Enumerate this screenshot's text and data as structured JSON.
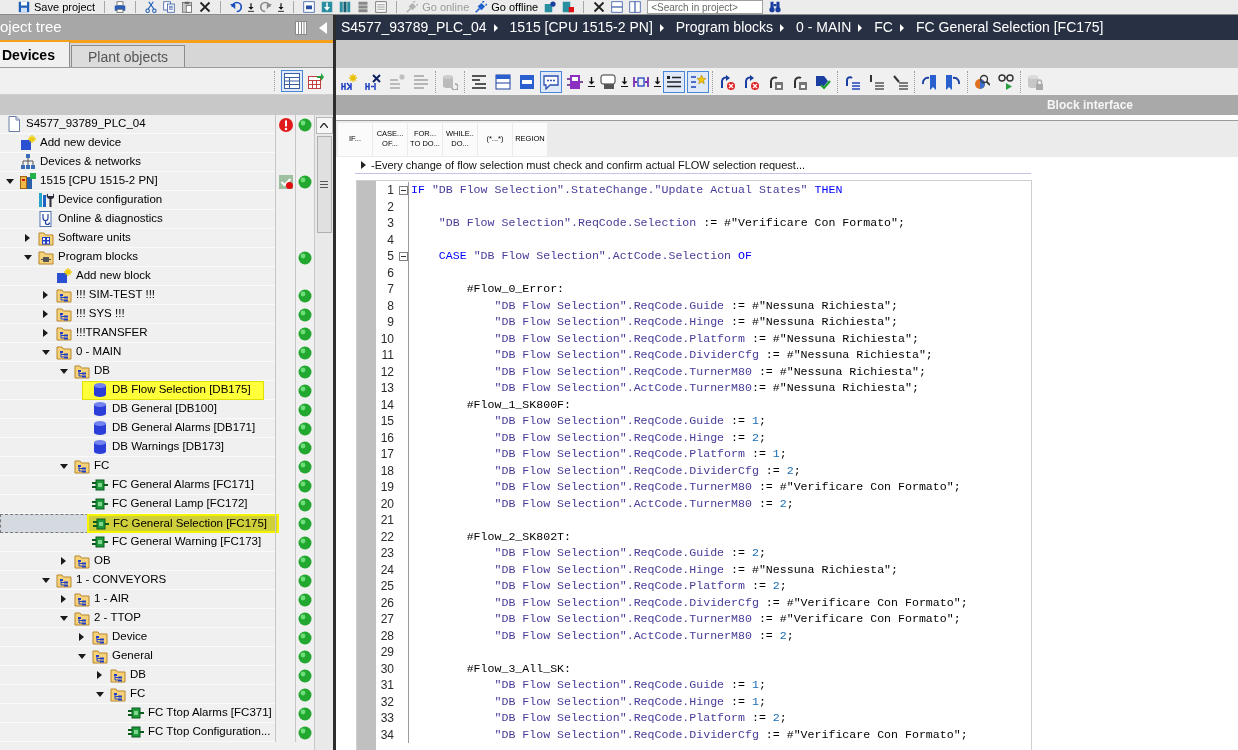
{
  "main_toolbar": {
    "save": {
      "label": "Save project",
      "disabled": false
    },
    "go_online": {
      "label": "Go online",
      "disabled": true
    },
    "go_offline": {
      "label": "Go offline",
      "disabled": false
    },
    "search": {
      "placeholder": "<Search in project>"
    }
  },
  "project_tree": {
    "title": "oject tree",
    "tabs": [
      {
        "label": "Devices",
        "selected": true
      },
      {
        "label": "Plant objects",
        "selected": false
      }
    ],
    "toolbar": [
      {
        "on": true
      },
      {
        "on": false
      }
    ],
    "items": [
      {
        "label": "S4577_93789_PLC_04",
        "kind": "project",
        "selected": false,
        "highlighted": false,
        "error_mark": true,
        "status_dot": true,
        "children": [
          {
            "label": "Add new device",
            "kind": "add-device",
            "selected": false,
            "highlighted": false
          },
          {
            "label": "Devices & networks",
            "kind": "network",
            "selected": false,
            "highlighted": false
          },
          {
            "label": "1515 [CPU 1515-2 PN]",
            "kind": "cpu",
            "selected": false,
            "highlighted": false,
            "expanded": true,
            "check_mark": true,
            "status_dot": true,
            "children": [
              {
                "label": "Device configuration",
                "kind": "device-config",
                "selected": false,
                "highlighted": false
              },
              {
                "label": "Online & diagnostics",
                "kind": "diagnostics",
                "selected": false,
                "highlighted": false
              },
              {
                "label": "Software units",
                "kind": "software-units",
                "selected": false,
                "highlighted": false,
                "expanded": false
              },
              {
                "label": "Program blocks",
                "kind": "program-blocks",
                "selected": false,
                "highlighted": false,
                "expanded": true,
                "status_dot": true,
                "children": [
                  {
                    "label": "Add new block",
                    "kind": "add-block",
                    "selected": false,
                    "highlighted": false
                  },
                  {
                    "label": "!!! SIM-TEST !!!",
                    "kind": "group",
                    "selected": false,
                    "highlighted": false,
                    "expanded": false,
                    "status_dot": true
                  },
                  {
                    "label": "!!! SYS !!!",
                    "kind": "group",
                    "selected": false,
                    "highlighted": false,
                    "expanded": false,
                    "status_dot": true
                  },
                  {
                    "label": "!!!TRANSFER",
                    "kind": "group",
                    "selected": false,
                    "highlighted": false,
                    "expanded": false,
                    "status_dot": true
                  },
                  {
                    "label": "0 - MAIN",
                    "kind": "group",
                    "selected": false,
                    "highlighted": false,
                    "expanded": true,
                    "status_dot": true,
                    "children": [
                      {
                        "label": "DB",
                        "kind": "group",
                        "selected": false,
                        "highlighted": false,
                        "expanded": true,
                        "status_dot": true,
                        "children": [
                          {
                            "label": "DB Flow Selection [DB175]",
                            "kind": "db",
                            "selected": false,
                            "highlighted": true,
                            "status_dot": true
                          },
                          {
                            "label": "DB General [DB100]",
                            "kind": "db",
                            "selected": false,
                            "highlighted": false,
                            "status_dot": true
                          },
                          {
                            "label": "DB General Alarms [DB171]",
                            "kind": "db",
                            "selected": false,
                            "highlighted": false,
                            "status_dot": true
                          },
                          {
                            "label": "DB Warnings [DB173]",
                            "kind": "db",
                            "selected": false,
                            "highlighted": false,
                            "status_dot": true
                          }
                        ]
                      },
                      {
                        "label": "FC",
                        "kind": "group",
                        "selected": false,
                        "highlighted": false,
                        "expanded": true,
                        "status_dot": true,
                        "children": [
                          {
                            "label": "FC General Alarms [FC171]",
                            "kind": "fc",
                            "selected": false,
                            "highlighted": false,
                            "status_dot": true
                          },
                          {
                            "label": "FC General Lamp [FC172]",
                            "kind": "fc",
                            "selected": false,
                            "highlighted": false,
                            "status_dot": true
                          },
                          {
                            "label": "FC General Selection [FC175]",
                            "kind": "fc",
                            "selected": true,
                            "highlighted": true,
                            "status_dot": true
                          },
                          {
                            "label": "FC General Warning [FC173]",
                            "kind": "fc",
                            "selected": false,
                            "highlighted": false,
                            "status_dot": true
                          }
                        ]
                      },
                      {
                        "label": "OB",
                        "kind": "group",
                        "selected": false,
                        "highlighted": false,
                        "expanded": false,
                        "status_dot": true
                      }
                    ]
                  },
                  {
                    "label": "1 - CONVEYORS",
                    "kind": "group",
                    "selected": false,
                    "highlighted": false,
                    "expanded": true,
                    "status_dot": true,
                    "children": [
                      {
                        "label": "1 - AIR",
                        "kind": "group",
                        "selected": false,
                        "highlighted": false,
                        "expanded": false,
                        "status_dot": true
                      },
                      {
                        "label": "2 - TTOP",
                        "kind": "group",
                        "selected": false,
                        "highlighted": false,
                        "expanded": true,
                        "status_dot": true,
                        "children": [
                          {
                            "label": "Device",
                            "kind": "group",
                            "selected": false,
                            "highlighted": false,
                            "expanded": false,
                            "status_dot": true
                          },
                          {
                            "label": "General",
                            "kind": "group",
                            "selected": false,
                            "highlighted": false,
                            "expanded": true,
                            "status_dot": true,
                            "children": [
                              {
                                "label": "DB",
                                "kind": "group",
                                "selected": false,
                                "highlighted": false,
                                "expanded": false,
                                "status_dot": true
                              },
                              {
                                "label": "FC",
                                "kind": "group",
                                "selected": false,
                                "highlighted": false,
                                "expanded": true,
                                "status_dot": true,
                                "children": [
                                  {
                                    "label": "FC Ttop Alarms [FC371]",
                                    "kind": "fc",
                                    "selected": false,
                                    "highlighted": false,
                                    "status_dot": true
                                  },
                                  {
                                    "label": "FC Ttop Configuration...",
                                    "kind": "fc",
                                    "selected": false,
                                    "highlighted": false,
                                    "status_dot": true
                                  }
                                ]
                              }
                            ]
                          }
                        ]
                      }
                    ]
                  }
                ]
              }
            ]
          }
        ]
      }
    ]
  },
  "editor": {
    "breadcrumb": [
      "S4577_93789_PLC_04",
      "1515 [CPU 1515-2 PN]",
      "Program blocks",
      "0 - MAIN",
      "FC",
      "FC General Selection [FC175]"
    ],
    "toolbar": {
      "groups": [
        [
          {
            "on": false,
            "disabled": false
          },
          {
            "on": false,
            "disabled": false
          },
          {
            "on": false,
            "disabled": true
          },
          {
            "on": false,
            "disabled": true
          }
        ],
        [
          {
            "on": false,
            "disabled": true
          }
        ],
        [
          {
            "on": false,
            "disabled": false
          },
          {
            "on": false,
            "disabled": false
          },
          {
            "on": false,
            "disabled": false
          },
          {
            "on": true,
            "disabled": false
          },
          {
            "on": false,
            "disabled": false
          },
          {
            "on": false,
            "disabled": false
          },
          {
            "on": false,
            "disabled": false
          },
          {
            "on": true,
            "disabled": false
          },
          {
            "on": true,
            "disabled": false
          }
        ],
        [
          {
            "on": false,
            "disabled": false
          },
          {
            "on": false,
            "disabled": false
          },
          {
            "on": false,
            "disabled": false
          },
          {
            "on": false,
            "disabled": false
          },
          {
            "on": false,
            "disabled": false
          }
        ],
        [
          {
            "on": false,
            "disabled": false
          },
          {
            "on": false,
            "disabled": false
          },
          {
            "on": false,
            "disabled": false
          }
        ],
        [
          {
            "on": false,
            "disabled": false
          },
          {
            "on": false,
            "disabled": false
          }
        ],
        [
          {
            "on": false,
            "disabled": false
          },
          {
            "on": false,
            "disabled": false
          }
        ],
        [
          {
            "on": false,
            "disabled": true
          }
        ]
      ]
    },
    "block_interface": {
      "label": "Block interface"
    },
    "instructions": [
      {
        "lines": [
          "IF..."
        ]
      },
      {
        "lines": [
          "CASE...",
          "OF..."
        ]
      },
      {
        "lines": [
          "FOR...",
          "TO DO..."
        ]
      },
      {
        "lines": [
          "WHILE..",
          "DO..."
        ]
      },
      {
        "lines": [
          "(*...*)"
        ]
      },
      {
        "lines": [
          "REGION"
        ]
      }
    ],
    "comment": {
      "text": "-Every change of flow selection must check and confirm actual FLOW selection request...",
      "expanded": false
    },
    "code": {
      "lines": [
        {
          "number": "1",
          "expanded": true,
          "tokens": [
            {
              "kind": "keyword",
              "text": "IF"
            },
            {
              "kind": "tag",
              "text": " \"DB Flow Selection\".StateChange.\"Update Actual States\" "
            },
            {
              "kind": "keyword",
              "text": "THEN"
            }
          ]
        },
        {
          "number": "2"
        },
        {
          "number": "3",
          "tokens": [
            {
              "kind": "tag",
              "text": "    \"DB Flow Selection\".ReqCode.Selection"
            },
            {
              "kind": "plain",
              "text": " := #\"Verificare Con Formato\";"
            }
          ]
        },
        {
          "number": "4"
        },
        {
          "number": "5",
          "expanded": true,
          "tokens": [
            {
              "kind": "keyword",
              "text": "    CASE"
            },
            {
              "kind": "tag",
              "text": " \"DB Flow Selection\".ActCode.Selection "
            },
            {
              "kind": "keyword",
              "text": "OF"
            }
          ]
        },
        {
          "number": "6"
        },
        {
          "number": "7",
          "tokens": [
            {
              "kind": "plain",
              "text": "        #Flow_0_Error:"
            }
          ]
        },
        {
          "number": "8",
          "tokens": [
            {
              "kind": "tag",
              "text": "            \"DB Flow Selection\".ReqCode.Guide"
            },
            {
              "kind": "plain",
              "text": " := #\"Nessuna Richiesta\";"
            }
          ]
        },
        {
          "number": "9",
          "tokens": [
            {
              "kind": "tag",
              "text": "            \"DB Flow Selection\".ReqCode.Hinge"
            },
            {
              "kind": "plain",
              "text": " := #\"Nessuna Richiesta\";"
            }
          ]
        },
        {
          "number": "10",
          "tokens": [
            {
              "kind": "tag",
              "text": "            \"DB Flow Selection\".ReqCode.Platform"
            },
            {
              "kind": "plain",
              "text": " := #\"Nessuna Richiesta\";"
            }
          ]
        },
        {
          "number": "11",
          "tokens": [
            {
              "kind": "tag",
              "text": "            \"DB Flow Selection\".ReqCode.DividerCfg"
            },
            {
              "kind": "plain",
              "text": " := #\"Nessuna Richiesta\";"
            }
          ]
        },
        {
          "number": "12",
          "tokens": [
            {
              "kind": "tag",
              "text": "            \"DB Flow Selection\".ReqCode.TurnerM80"
            },
            {
              "kind": "plain",
              "text": " := #\"Nessuna Richiesta\";"
            }
          ]
        },
        {
          "number": "13",
          "tokens": [
            {
              "kind": "tag",
              "text": "            \"DB Flow Selection\".ActCode.TurnerM80"
            },
            {
              "kind": "plain",
              "text": ":= #\"Nessuna Richiesta\";"
            }
          ]
        },
        {
          "number": "14",
          "tokens": [
            {
              "kind": "plain",
              "text": "        #Flow_1_SK800F:"
            }
          ]
        },
        {
          "number": "15",
          "tokens": [
            {
              "kind": "tag",
              "text": "            \"DB Flow Selection\".ReqCode.Guide"
            },
            {
              "kind": "plain",
              "text": " := "
            },
            {
              "kind": "number",
              "text": "1"
            },
            {
              "kind": "plain",
              "text": ";"
            }
          ]
        },
        {
          "number": "16",
          "tokens": [
            {
              "kind": "tag",
              "text": "            \"DB Flow Selection\".ReqCode.Hinge"
            },
            {
              "kind": "plain",
              "text": " := "
            },
            {
              "kind": "number",
              "text": "2"
            },
            {
              "kind": "plain",
              "text": ";"
            }
          ]
        },
        {
          "number": "17",
          "tokens": [
            {
              "kind": "tag",
              "text": "            \"DB Flow Selection\".ReqCode.Platform"
            },
            {
              "kind": "plain",
              "text": " := "
            },
            {
              "kind": "number",
              "text": "1"
            },
            {
              "kind": "plain",
              "text": ";"
            }
          ]
        },
        {
          "number": "18",
          "tokens": [
            {
              "kind": "tag",
              "text": "            \"DB Flow Selection\".ReqCode.DividerCfg"
            },
            {
              "kind": "plain",
              "text": " := "
            },
            {
              "kind": "number",
              "text": "2"
            },
            {
              "kind": "plain",
              "text": ";"
            }
          ]
        },
        {
          "number": "19",
          "tokens": [
            {
              "kind": "tag",
              "text": "            \"DB Flow Selection\".ReqCode.TurnerM80"
            },
            {
              "kind": "plain",
              "text": " := #\"Verificare Con Formato\";"
            }
          ]
        },
        {
          "number": "20",
          "tokens": [
            {
              "kind": "tag",
              "text": "            \"DB Flow Selection\".ActCode.TurnerM80"
            },
            {
              "kind": "plain",
              "text": " := "
            },
            {
              "kind": "number",
              "text": "2"
            },
            {
              "kind": "plain",
              "text": ";"
            }
          ]
        },
        {
          "number": "21"
        },
        {
          "number": "22",
          "tokens": [
            {
              "kind": "plain",
              "text": "        #Flow_2_SK802T:"
            }
          ]
        },
        {
          "number": "23",
          "tokens": [
            {
              "kind": "tag",
              "text": "            \"DB Flow Selection\".ReqCode.Guide"
            },
            {
              "kind": "plain",
              "text": " := "
            },
            {
              "kind": "number",
              "text": "2"
            },
            {
              "kind": "plain",
              "text": ";"
            }
          ]
        },
        {
          "number": "24",
          "tokens": [
            {
              "kind": "tag",
              "text": "            \"DB Flow Selection\".ReqCode.Hinge"
            },
            {
              "kind": "plain",
              "text": " := #\"Nessuna Richiesta\";"
            }
          ]
        },
        {
          "number": "25",
          "tokens": [
            {
              "kind": "tag",
              "text": "            \"DB Flow Selection\".ReqCode.Platform"
            },
            {
              "kind": "plain",
              "text": " := "
            },
            {
              "kind": "number",
              "text": "2"
            },
            {
              "kind": "plain",
              "text": ";"
            }
          ]
        },
        {
          "number": "26",
          "tokens": [
            {
              "kind": "tag",
              "text": "            \"DB Flow Selection\".ReqCode.DividerCfg"
            },
            {
              "kind": "plain",
              "text": " := #\"Verificare Con Formato\";"
            }
          ]
        },
        {
          "number": "27",
          "tokens": [
            {
              "kind": "tag",
              "text": "            \"DB Flow Selection\".ReqCode.TurnerM80"
            },
            {
              "kind": "plain",
              "text": " := #\"Verificare Con Formato\";"
            }
          ]
        },
        {
          "number": "28",
          "tokens": [
            {
              "kind": "tag",
              "text": "            \"DB Flow Selection\".ActCode.TurnerM80"
            },
            {
              "kind": "plain",
              "text": " := "
            },
            {
              "kind": "number",
              "text": "2"
            },
            {
              "kind": "plain",
              "text": ";"
            }
          ]
        },
        {
          "number": "29"
        },
        {
          "number": "30",
          "tokens": [
            {
              "kind": "plain",
              "text": "        #Flow_3_All_SK:"
            }
          ]
        },
        {
          "number": "31",
          "tokens": [
            {
              "kind": "tag",
              "text": "            \"DB Flow Selection\".ReqCode.Guide"
            },
            {
              "kind": "plain",
              "text": " := "
            },
            {
              "kind": "number",
              "text": "1"
            },
            {
              "kind": "plain",
              "text": ";"
            }
          ]
        },
        {
          "number": "32",
          "tokens": [
            {
              "kind": "tag",
              "text": "            \"DB Flow Selection\".ReqCode.Hinge"
            },
            {
              "kind": "plain",
              "text": " := "
            },
            {
              "kind": "number",
              "text": "1"
            },
            {
              "kind": "plain",
              "text": ";"
            }
          ]
        },
        {
          "number": "33",
          "tokens": [
            {
              "kind": "tag",
              "text": "            \"DB Flow Selection\".ReqCode.Platform"
            },
            {
              "kind": "plain",
              "text": " := "
            },
            {
              "kind": "number",
              "text": "2"
            },
            {
              "kind": "plain",
              "text": ";"
            }
          ]
        },
        {
          "number": "34",
          "tokens": [
            {
              "kind": "tag",
              "text": "            \"DB Flow Selection\".ReqCode.DividerCfg"
            },
            {
              "kind": "plain",
              "text": " := #\"Verificare Con Formato\";"
            }
          ]
        }
      ]
    }
  }
}
